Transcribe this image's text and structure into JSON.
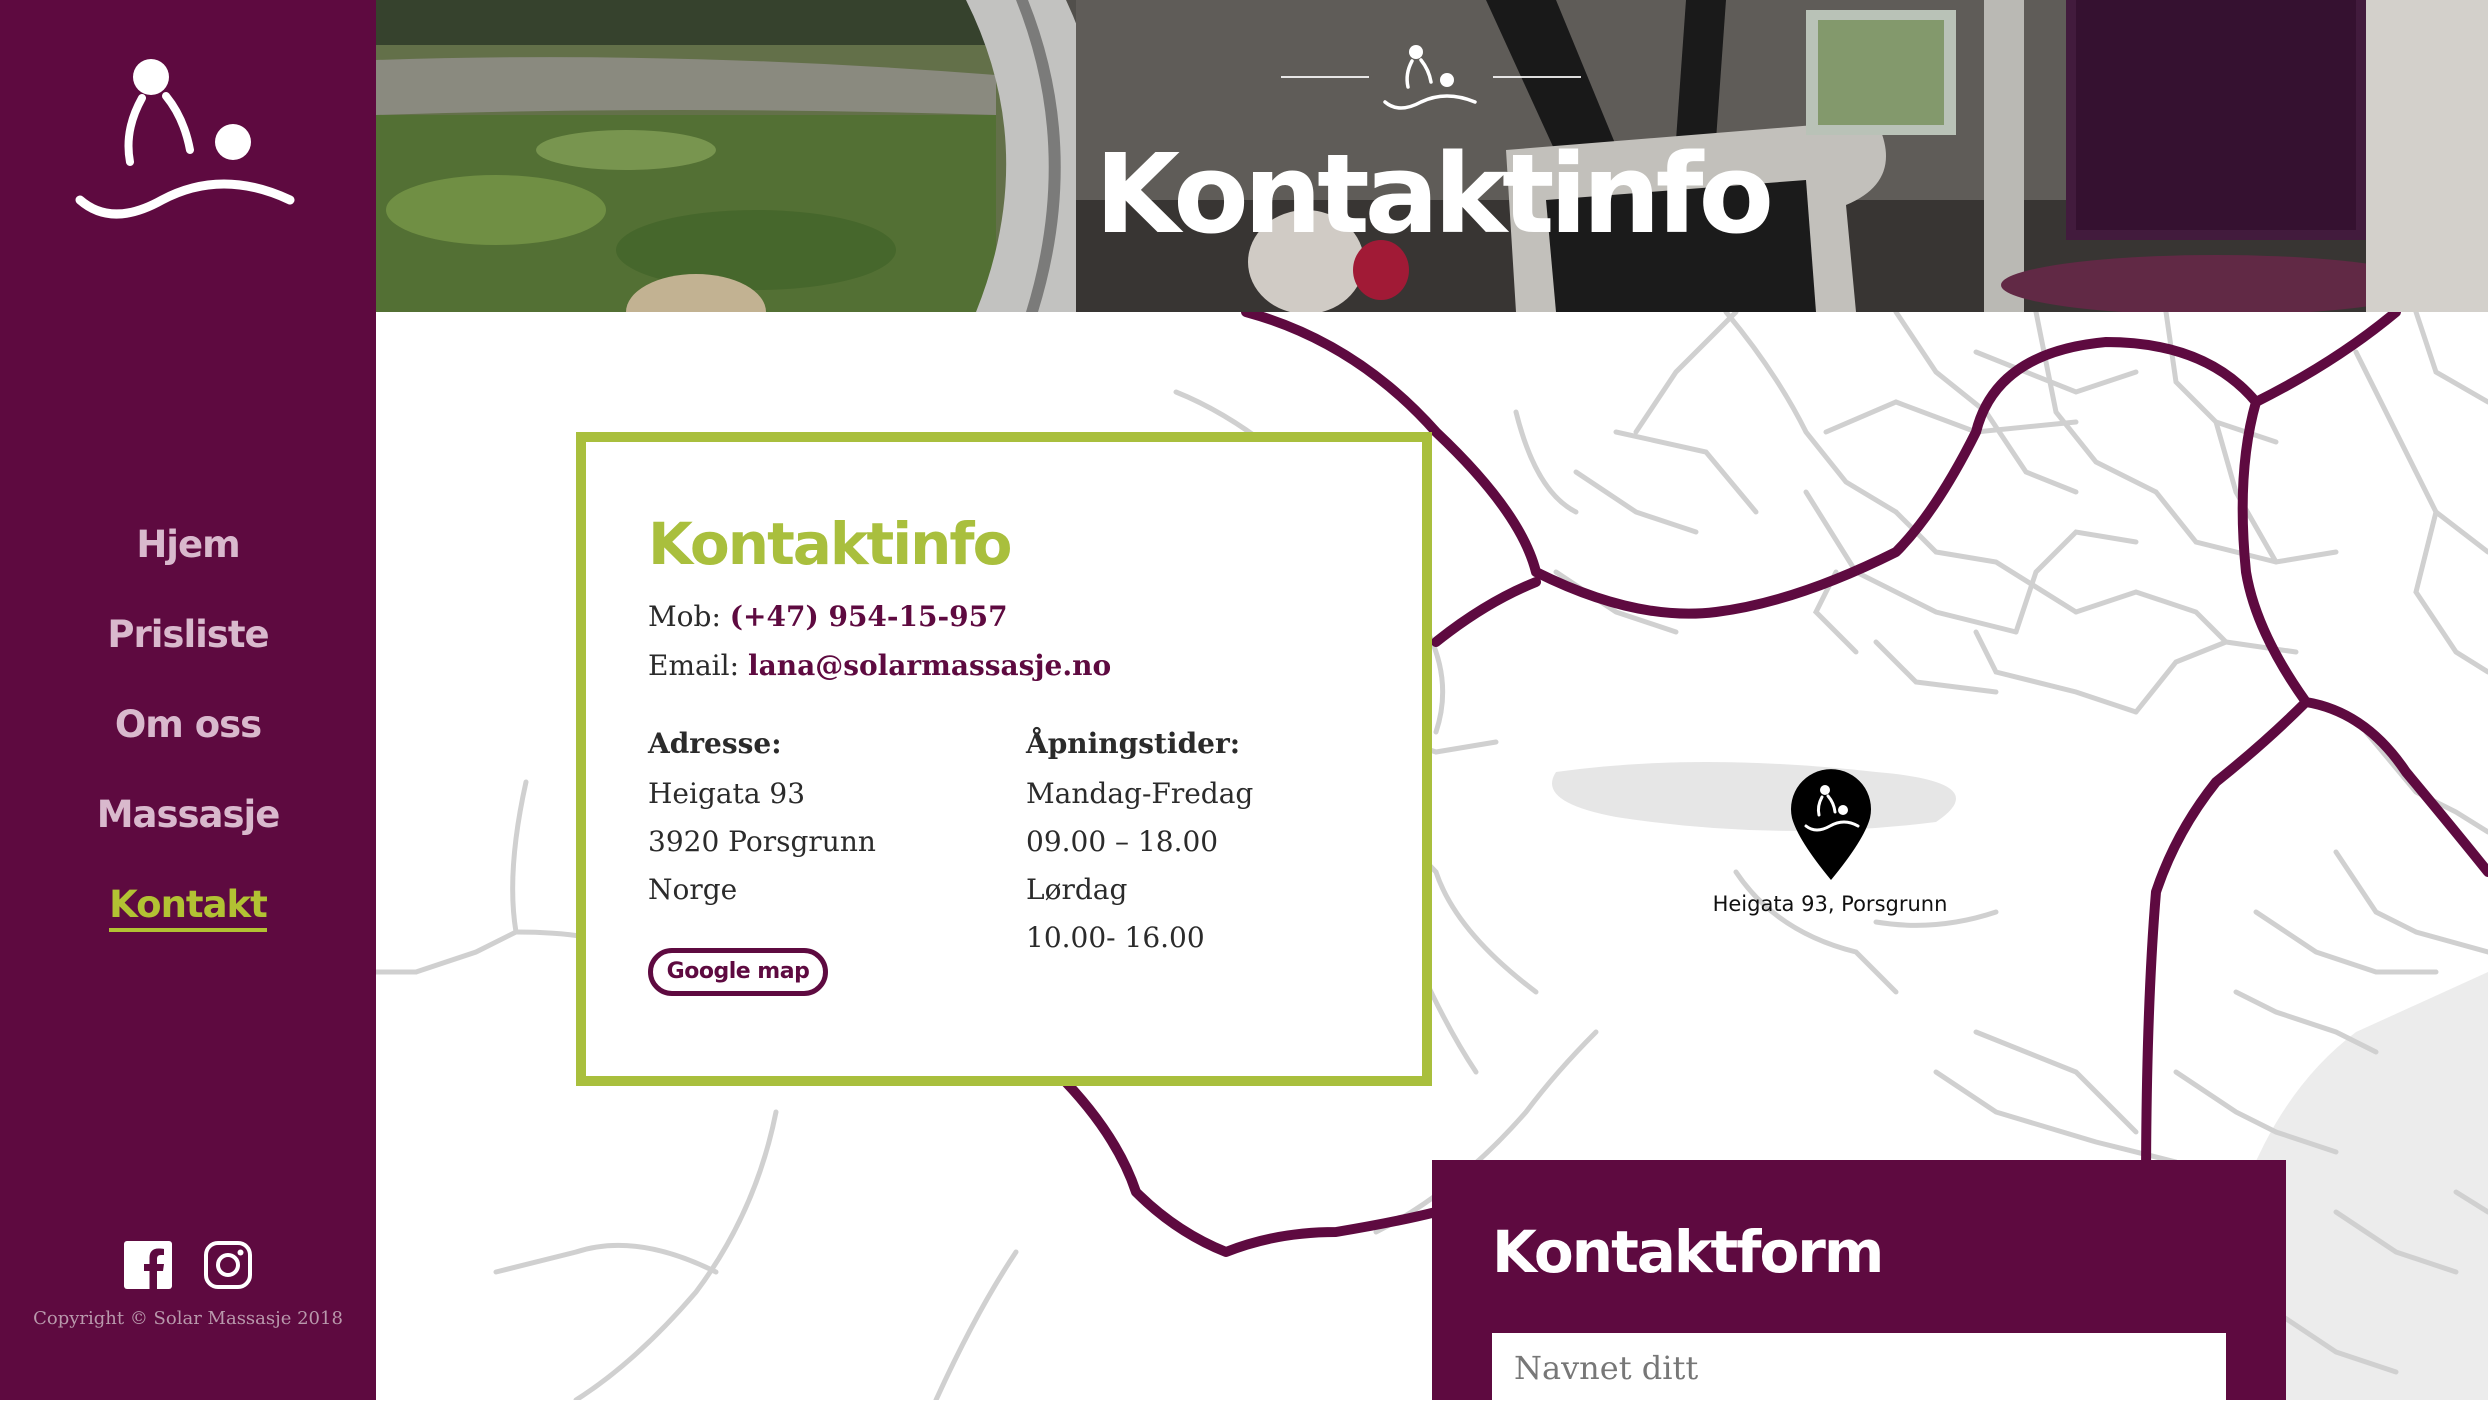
{
  "brand": {
    "name": "Solar Massasje",
    "accent_color": "#5e0a40",
    "highlight_color": "#a9bf3d"
  },
  "logo": {
    "icon": "massage-logo-icon"
  },
  "nav": {
    "items": [
      {
        "label": "Hjem"
      },
      {
        "label": "Prisliste"
      },
      {
        "label": "Om oss"
      },
      {
        "label": "Massasje"
      },
      {
        "label": "Kontakt",
        "active": true
      }
    ]
  },
  "social": {
    "icons": [
      "facebook-icon",
      "instagram-icon"
    ]
  },
  "footer": {
    "copyright": "Copyright © Solar Massasje 2018"
  },
  "hero": {
    "title": "Kontaktinfo"
  },
  "contact_card": {
    "title": "Kontaktinfo",
    "mobile_label": "Mob:",
    "mobile_value": "(+47) 954-15-957",
    "email_label": "Email:",
    "email_value": "lana@solarmassasje.no",
    "address": {
      "heading": "Adresse:",
      "lines": [
        "Heigata 93",
        "3920 Porsgrunn",
        "Norge"
      ]
    },
    "hours": {
      "heading": "Åpningstider:",
      "lines": [
        "Mandag-Fredag",
        "09.00 – 18.00",
        "Lørdag",
        "10.00- 16.00"
      ]
    },
    "map_button": "Google map"
  },
  "map": {
    "pin_label": "Heigata 93, Porsgrunn",
    "pin_icon": "map-pin-icon"
  },
  "contact_form": {
    "title": "Kontaktform",
    "name_placeholder": "Navnet ditt"
  }
}
